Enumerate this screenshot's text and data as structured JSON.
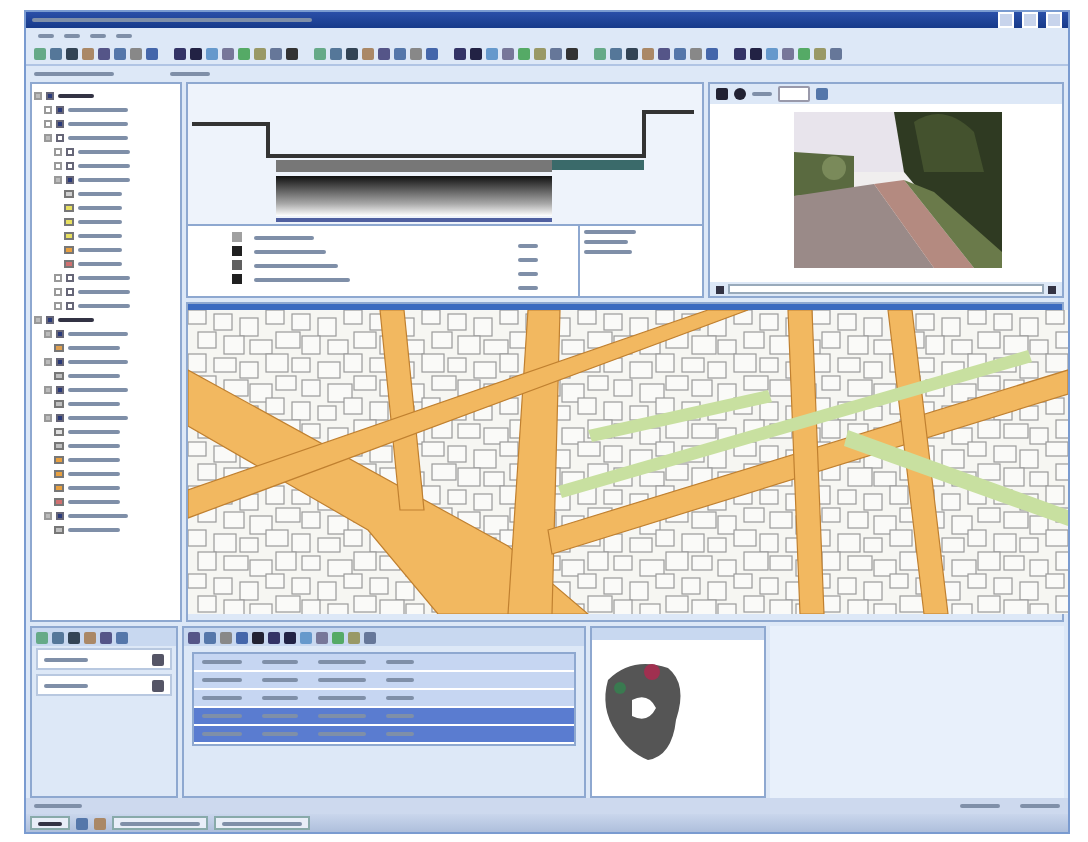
{
  "tree": [
    {
      "expanded": true,
      "checked": true,
      "children": [
        {
          "expanded": false,
          "checked": true
        },
        {
          "expanded": false,
          "checked": true
        },
        {
          "expanded": true,
          "checked": false,
          "children": [
            {
              "expanded": false,
              "checked": false
            },
            {
              "expanded": false,
              "checked": false
            },
            {
              "expanded": true,
              "checked": true,
              "children": [
                {
                  "color": "#d0d0d0"
                },
                {
                  "color": "#e8e060"
                },
                {
                  "color": "#e8e060"
                },
                {
                  "color": "#e8e060"
                },
                {
                  "color": "#e8a040"
                },
                {
                  "color": "#d07070"
                }
              ]
            },
            {
              "expanded": false,
              "checked": false
            },
            {
              "expanded": false,
              "checked": false
            },
            {
              "expanded": false,
              "checked": false
            }
          ]
        }
      ]
    },
    {
      "expanded": true,
      "checked": true,
      "children": [
        {
          "expanded": true,
          "checked": true,
          "children": [
            {
              "color": "#e0a050"
            }
          ]
        },
        {
          "expanded": true,
          "checked": true,
          "children": [
            {
              "color": "#c0c0c0"
            }
          ]
        },
        {
          "expanded": true,
          "checked": true,
          "children": [
            {
              "color": "#c0c0c0"
            }
          ]
        },
        {
          "expanded": true,
          "checked": true,
          "children": [
            {
              "color": "#e0e0e0"
            },
            {
              "color": "#c0c0c0"
            },
            {
              "color": "#e8a040"
            },
            {
              "color": "#e8a040"
            },
            {
              "color": "#e8a040"
            },
            {
              "color": "#d07070"
            }
          ]
        },
        {
          "expanded": true,
          "checked": true,
          "children": [
            {
              "color": "#c0c0c0"
            }
          ]
        }
      ]
    }
  ],
  "legend": [
    {
      "color": "#a0a0a0"
    },
    {
      "color": "#202020"
    },
    {
      "color": "#606060"
    },
    {
      "color": "#202020"
    }
  ],
  "layer_rows": [
    {
      "selected": false
    },
    {
      "selected": false
    }
  ],
  "attribute_rows": [
    {
      "selected": false
    },
    {
      "selected": false
    },
    {
      "selected": false
    },
    {
      "selected": true
    },
    {
      "selected": true
    }
  ]
}
